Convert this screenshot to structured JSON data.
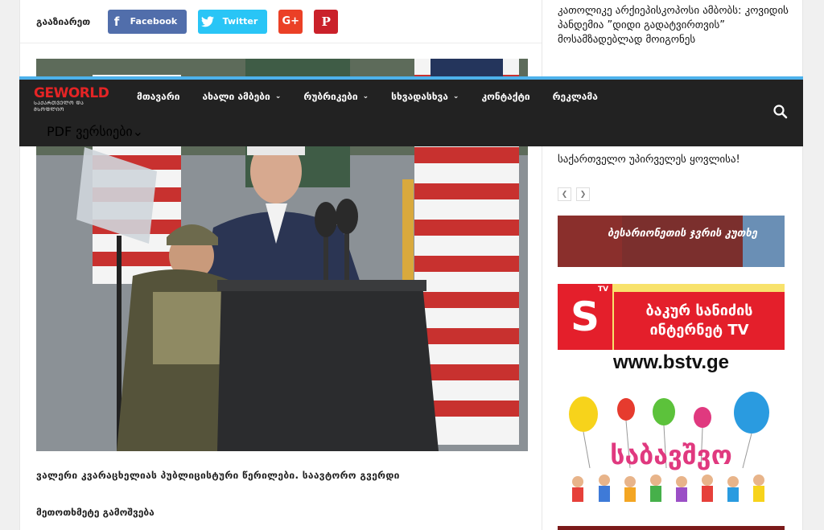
{
  "share": {
    "label": "გააზიარეთ",
    "facebook": "Facebook",
    "twitter": "Twitter",
    "gplus_icon": "G+",
    "pinterest_icon": "P"
  },
  "nav": {
    "logo_text": "GEWORLD",
    "logo_sub": "ᲡᲐᲥᲐᲠᲗᲕᲔᲚᲝ ᲓᲐ ᲛᲡᲝᲤᲚᲘᲝ",
    "items": [
      {
        "label": "მთავარი",
        "has_dropdown": false
      },
      {
        "label": "ახალი ამბები",
        "has_dropdown": true
      },
      {
        "label": "რუბრიკები",
        "has_dropdown": true
      },
      {
        "label": "სხვადასხვა",
        "has_dropdown": true
      },
      {
        "label": "კონტაქტი",
        "has_dropdown": false
      },
      {
        "label": "რეკლამა",
        "has_dropdown": false
      }
    ],
    "items_row2": [
      {
        "label": "PDF ვერსიები",
        "has_dropdown": true
      }
    ],
    "search_icon": "search-icon"
  },
  "article": {
    "caption": "ვალერი კვარაცხელიას პუბლიცისტური წერილები. საავტორო გვერდი",
    "subcaption": "მეთოთხმეტე გამოშვება"
  },
  "sidebar": {
    "headline": "კათოლიკე არქიეპისკოპოსი ამბობს: კოვიდის პანდემია ”დიდი გადატვირთვის” მოსამზადებლად მოიგონეს",
    "headline2": "საქართველო უპირველეს ყოვლისა!",
    "ad1_text": "ბესარიონეთის ჯვრის კუთხე",
    "ad2_title": "ბაკურ სანიძის ინტერნეტ TV",
    "ad2_url": "www.bstv.ge",
    "ad2_logo": "S",
    "ad2_logo_sup": "TV",
    "ad3_text": "საბავშვო"
  },
  "colors": {
    "nav_bg": "#222222",
    "nav_accent": "#4db2ec",
    "logo_red": "#e52425",
    "facebook": "#516eab",
    "twitter": "#29c5f6",
    "gplus": "#eb4026",
    "pinterest": "#ca212a"
  }
}
